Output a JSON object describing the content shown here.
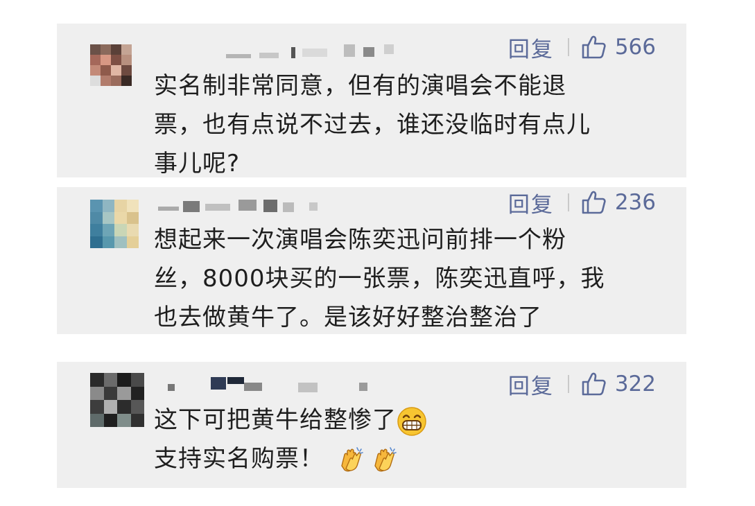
{
  "comments": [
    {
      "reply_label": "回复",
      "likes": "566",
      "lines": [
        "实名制非常同意，但有的演唱会不能退",
        "票，也有点说不过去，谁还没临时有点儿",
        "事儿呢?"
      ]
    },
    {
      "reply_label": "回复",
      "likes": "236",
      "lines": [
        "想起来一次演唱会陈奕迅问前排一个粉",
        "丝，8000块买的一张票，陈奕迅直呼，我",
        "也去做黄牛了。是该好好整治整治了"
      ]
    },
    {
      "reply_label": "回复",
      "likes": "322",
      "lines": [
        "这下可把黄牛给整惨了",
        "支持实名购票！"
      ]
    }
  ],
  "colors": {
    "card_bg": "#efefef",
    "action_text": "#5b6a99",
    "body_text": "#1e1e1e"
  },
  "icons": [
    "thumbs-up-icon",
    "grinning-face-emoji",
    "clapping-hands-emoji"
  ]
}
